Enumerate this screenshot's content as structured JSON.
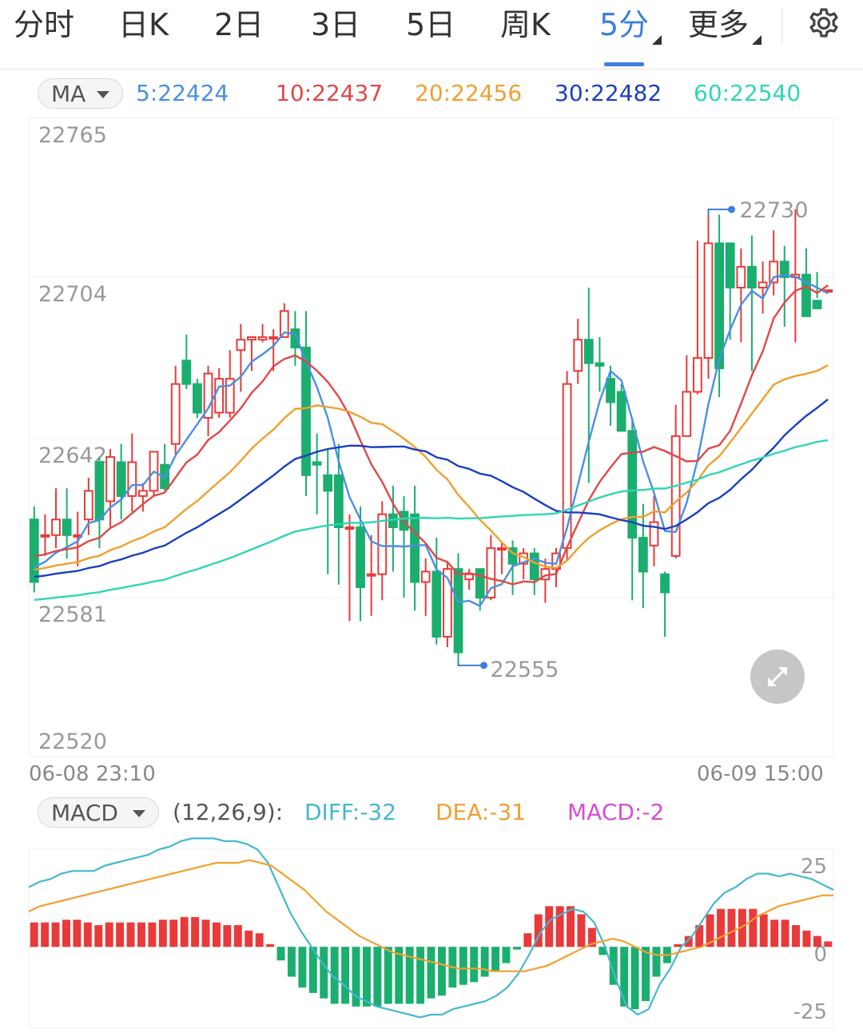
{
  "tabs": [
    {
      "label": "分时"
    },
    {
      "label": "日K"
    },
    {
      "label": "2日"
    },
    {
      "label": "3日"
    },
    {
      "label": "5日"
    },
    {
      "label": "周K"
    },
    {
      "label": "5分",
      "active": true,
      "has_menu": true
    },
    {
      "label": "更多",
      "has_menu": true
    }
  ],
  "icons": {
    "settings": "gear-icon",
    "zoom": "expand-arrows-icon",
    "dropdown": "caret-down-icon"
  },
  "colors": {
    "accent": "#3d7fe0",
    "up": "#e83a3a",
    "down": "#1aae6f",
    "ma5": "#4a90e2",
    "ma10": "#e04848",
    "ma20": "#f0a030",
    "ma30": "#1c3fbf",
    "ma60": "#2fd6b5",
    "diff": "#45b7d1",
    "dea": "#f0a030",
    "macd": "#d84dd6"
  },
  "ma_legend": {
    "selector": "MA",
    "items": [
      {
        "text": "5:22424",
        "color": "#4a90e2"
      },
      {
        "text": "10:22437",
        "color": "#e04848"
      },
      {
        "text": "20:22456",
        "color": "#f0a030"
      },
      {
        "text": "30:22482",
        "color": "#1c3fbf"
      },
      {
        "text": "60:22540",
        "color": "#2fd6b5"
      }
    ]
  },
  "macd_legend": {
    "selector": "MACD",
    "params": "(12,26,9):",
    "diff": "DIFF:-32",
    "dea": "DEA:-31",
    "macd": "MACD:-2"
  },
  "time_axis": {
    "start": "06-08 23:10",
    "end": "06-09 15:00"
  },
  "chart_data": [
    {
      "type": "candlestick",
      "y_ticks": [
        "22765",
        "22704",
        "22642",
        "22581",
        "22520"
      ],
      "ylim": [
        22520,
        22765
      ],
      "annotations": {
        "high": "22730",
        "low": "22555"
      },
      "candles": [
        [
          22611,
          22587,
          22616,
          22583
        ],
        [
          22605,
          22605,
          22613,
          22597
        ],
        [
          22605,
          22611,
          22623,
          22600
        ],
        [
          22611,
          22605,
          22623,
          22596
        ],
        [
          22605,
          22605,
          22614,
          22593
        ],
        [
          22611,
          22622,
          22627,
          22605
        ],
        [
          22633,
          22611,
          22635,
          22600
        ],
        [
          22618,
          22635,
          22638,
          22608
        ],
        [
          22633,
          22620,
          22640,
          22611
        ],
        [
          22620,
          22633,
          22644,
          22614
        ],
        [
          22620,
          22622,
          22625,
          22614
        ],
        [
          22622,
          22637,
          22636,
          22620
        ],
        [
          22632,
          22623,
          22640,
          22622
        ],
        [
          22640,
          22663,
          22670,
          22636
        ],
        [
          22672,
          22663,
          22682,
          22661
        ],
        [
          22663,
          22652,
          22665,
          22650
        ],
        [
          22650,
          22667,
          22670,
          22643
        ],
        [
          22652,
          22665,
          22669,
          22650
        ],
        [
          22652,
          22665,
          22676,
          22650
        ],
        [
          22676,
          22680,
          22686,
          22660
        ],
        [
          22680,
          22681,
          22681,
          22668
        ],
        [
          22680,
          22681,
          22686,
          22679
        ],
        [
          22681,
          22681,
          22684,
          22668
        ],
        [
          22681,
          22691,
          22694,
          22681
        ],
        [
          22684,
          22677,
          22691,
          22670
        ],
        [
          22677,
          22628,
          22691,
          22620
        ],
        [
          22633,
          22632,
          22644,
          22613
        ],
        [
          22628,
          22622,
          22638,
          22590
        ],
        [
          22628,
          22608,
          22640,
          22586
        ],
        [
          22608,
          22608,
          22613,
          22572
        ],
        [
          22608,
          22585,
          22616,
          22572
        ],
        [
          22590,
          22590,
          22605,
          22574
        ],
        [
          22590,
          22613,
          22618,
          22580
        ],
        [
          22613,
          22608,
          22624,
          22591
        ],
        [
          22614,
          22607,
          22620,
          22581
        ],
        [
          22613,
          22587,
          22624,
          22576
        ],
        [
          22587,
          22591,
          22596,
          22574
        ],
        [
          22591,
          22566,
          22604,
          22563
        ],
        [
          22566,
          22592,
          22595,
          22562
        ],
        [
          22592,
          22560,
          22598,
          22555
        ],
        [
          22588,
          22590,
          22592,
          22584
        ],
        [
          22592,
          22581,
          22587,
          22576
        ],
        [
          22581,
          22600,
          22605,
          22580
        ],
        [
          22600,
          22600,
          22602,
          22590
        ],
        [
          22600,
          22594,
          22603,
          22582
        ],
        [
          22594,
          22598,
          22600,
          22588
        ],
        [
          22598,
          22588,
          22600,
          22582
        ],
        [
          22588,
          22592,
          22596,
          22579
        ],
        [
          22592,
          22598,
          22600,
          22585
        ],
        [
          22600,
          22663,
          22668,
          22595
        ],
        [
          22668,
          22680,
          22688,
          22663
        ],
        [
          22680,
          22671,
          22700,
          22625
        ],
        [
          22671,
          22670,
          22681,
          22660
        ],
        [
          22665,
          22656,
          22670,
          22647
        ],
        [
          22660,
          22645,
          22663,
          22648
        ],
        [
          22645,
          22604,
          22650,
          22580
        ],
        [
          22604,
          22591,
          22617,
          22577
        ],
        [
          22601,
          22610,
          22620,
          22593
        ],
        [
          22590,
          22583,
          22591,
          22566
        ],
        [
          22597,
          22643,
          22655,
          22596
        ],
        [
          22643,
          22660,
          22674,
          22644
        ],
        [
          22660,
          22673,
          22718,
          22659
        ],
        [
          22673,
          22717,
          22730,
          22665
        ],
        [
          22717,
          22669,
          22728,
          22658
        ],
        [
          22717,
          22700,
          22706,
          22680
        ],
        [
          22700,
          22708,
          22715,
          22679
        ],
        [
          22708,
          22700,
          22720,
          22668
        ],
        [
          22700,
          22702,
          22710,
          22690
        ],
        [
          22702,
          22710,
          22722,
          22697
        ],
        [
          22710,
          22704,
          22716,
          22685
        ],
        [
          22704,
          22705,
          22730,
          22679
        ],
        [
          22705,
          22689,
          22715,
          22700
        ],
        [
          22695,
          22692,
          22706,
          22696
        ],
        [
          22699,
          22699,
          22697,
          22697
        ]
      ]
    },
    {
      "type": "line",
      "y_ticks": [
        "25",
        "0",
        "-25"
      ],
      "ylim": [
        -30,
        36
      ],
      "series": [
        {
          "name": "DIFF",
          "values": [
            22,
            24,
            25,
            27,
            28,
            28,
            28,
            30,
            31,
            32,
            33,
            34,
            36,
            37,
            39,
            40,
            40,
            40,
            39,
            39,
            38,
            36,
            31,
            22,
            13,
            6,
            0,
            -6,
            -11,
            -14,
            -18,
            -20,
            -22,
            -23,
            -24,
            -25,
            -26,
            -25,
            -25,
            -23,
            -22,
            -21,
            -20,
            -18,
            -15,
            -10,
            -3,
            5,
            10,
            12,
            14,
            13,
            9,
            0,
            -12,
            -22,
            -25,
            -23,
            -14,
            -8,
            0,
            4,
            10,
            16,
            20,
            22,
            25,
            27,
            27,
            26,
            27,
            26,
            25,
            23,
            21
          ]
        },
        {
          "name": "DEA",
          "values": [
            13,
            15,
            16,
            17,
            18,
            19,
            20,
            21,
            22,
            23,
            24,
            25,
            26,
            27,
            28,
            29,
            30,
            31,
            31,
            31,
            32,
            31,
            30,
            27,
            24,
            21,
            17,
            13,
            10,
            7,
            4,
            2,
            0,
            -2,
            -3,
            -4,
            -5,
            -6,
            -7,
            -8,
            -8,
            -8,
            -9,
            -9,
            -9,
            -9,
            -8,
            -7,
            -5,
            -3,
            -1,
            1,
            2,
            3,
            2,
            0,
            -2,
            -3,
            -3,
            -2,
            -1,
            0,
            2,
            4,
            6,
            8,
            11,
            13,
            15,
            16,
            17,
            18,
            19,
            19
          ]
        },
        {
          "name": "MACD",
          "values": [
            9,
            9,
            9,
            10,
            10,
            9,
            8,
            9,
            9,
            9,
            9,
            9,
            10,
            10,
            11,
            11,
            10,
            9,
            8,
            8,
            6,
            5,
            1,
            -5,
            -11,
            -15,
            -17,
            -19,
            -21,
            -21,
            -22,
            -22,
            -22,
            -21,
            -21,
            -21,
            -21,
            -19,
            -18,
            -15,
            -14,
            -13,
            -11,
            -9,
            -6,
            -1,
            5,
            12,
            15,
            15,
            15,
            12,
            7,
            -3,
            -14,
            -22,
            -23,
            -20,
            -11,
            -6,
            1,
            4,
            8,
            12,
            14,
            14,
            14,
            14,
            12,
            10,
            10,
            8,
            6,
            4,
            2
          ]
        }
      ]
    }
  ]
}
